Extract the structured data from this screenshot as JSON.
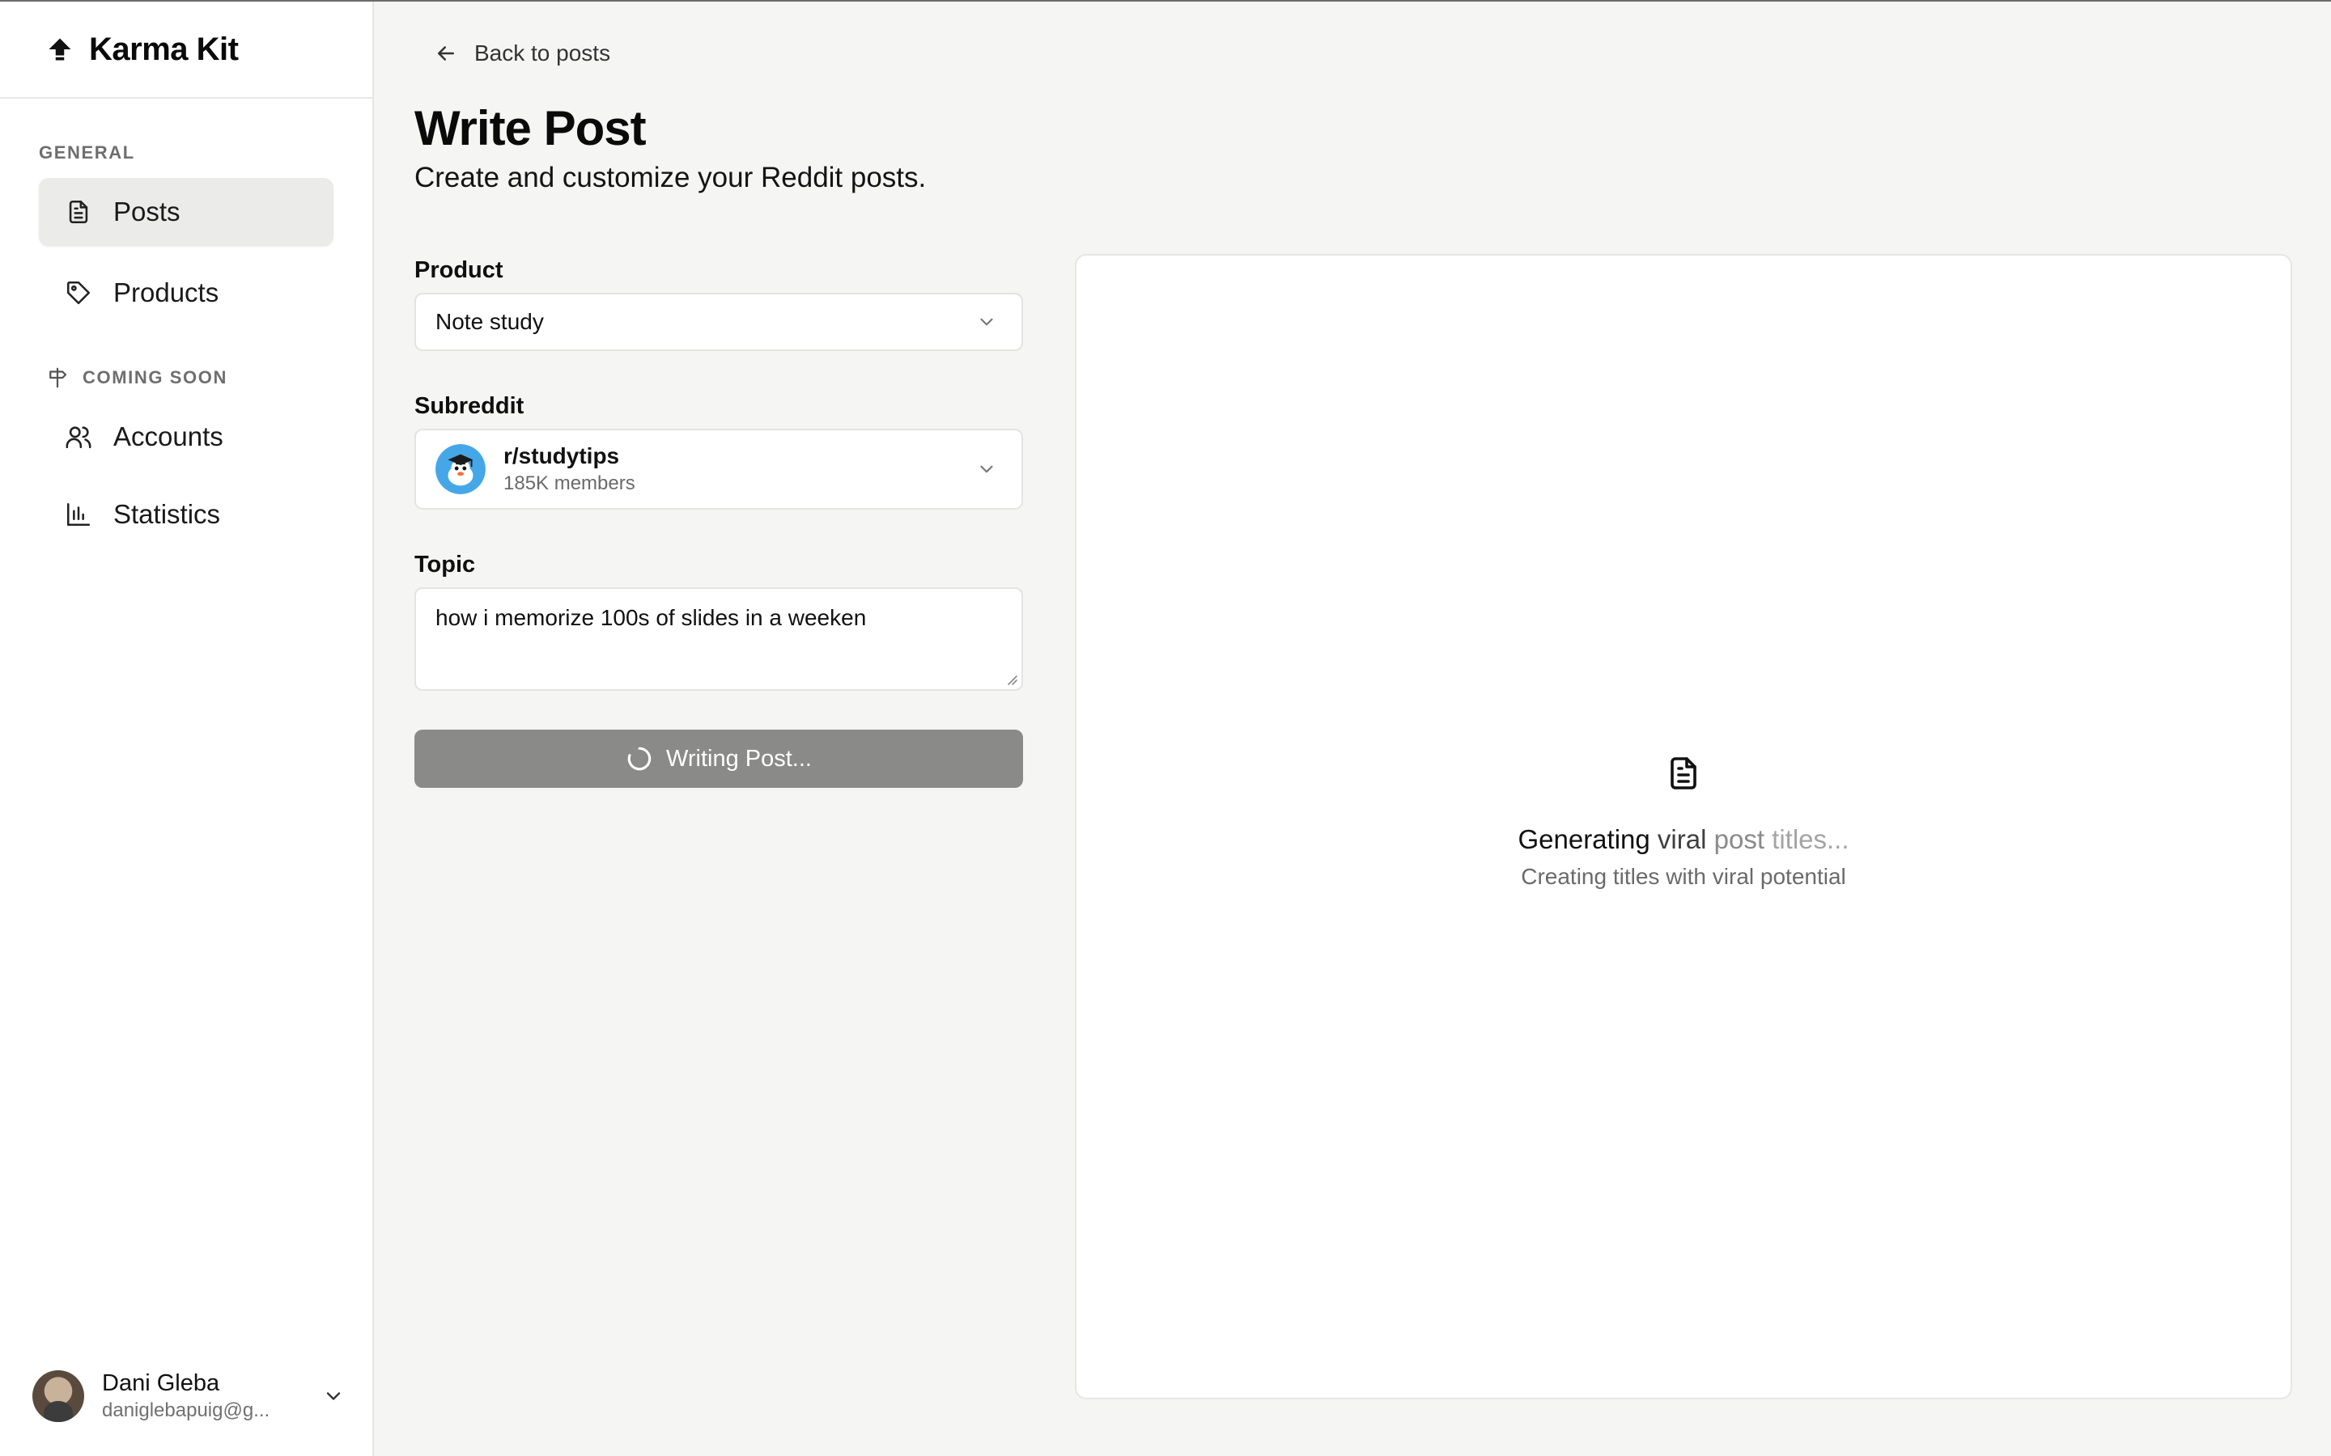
{
  "brand": {
    "name": "Karma Kit",
    "icon": "arrow-up-icon"
  },
  "sidebar": {
    "sections": [
      {
        "label": "GENERAL"
      },
      {
        "label": "COMING SOON",
        "icon": "signpost-icon"
      }
    ],
    "items": [
      {
        "label": "Posts",
        "icon": "file-text-icon",
        "active": true
      },
      {
        "label": "Products",
        "icon": "tag-icon",
        "active": false
      },
      {
        "label": "Accounts",
        "icon": "users-icon",
        "active": false
      },
      {
        "label": "Statistics",
        "icon": "bar-chart-icon",
        "active": false
      }
    ],
    "user": {
      "name": "Dani Gleba",
      "email": "daniglebapuig@g..."
    }
  },
  "main": {
    "back_label": "Back to posts",
    "title": "Write Post",
    "subtitle": "Create and customize your Reddit posts.",
    "form": {
      "product": {
        "label": "Product",
        "value": "Note study"
      },
      "subreddit": {
        "label": "Subreddit",
        "name": "r/studytips",
        "members": "185K members"
      },
      "topic": {
        "label": "Topic",
        "value": "how i memorize 100s of slides in a weeken"
      },
      "submit_label": "Writing Post..."
    },
    "preview": {
      "title_parts": [
        "Generating",
        "viral",
        "post",
        "titles..."
      ],
      "subtitle": "Creating titles with viral potential"
    }
  },
  "colors": {
    "background": "#f5f5f4",
    "sidebar": "#ffffff",
    "active_item": "#ebebea",
    "button_disabled": "#8a8a88",
    "subreddit_avatar": "#46a7e8"
  }
}
